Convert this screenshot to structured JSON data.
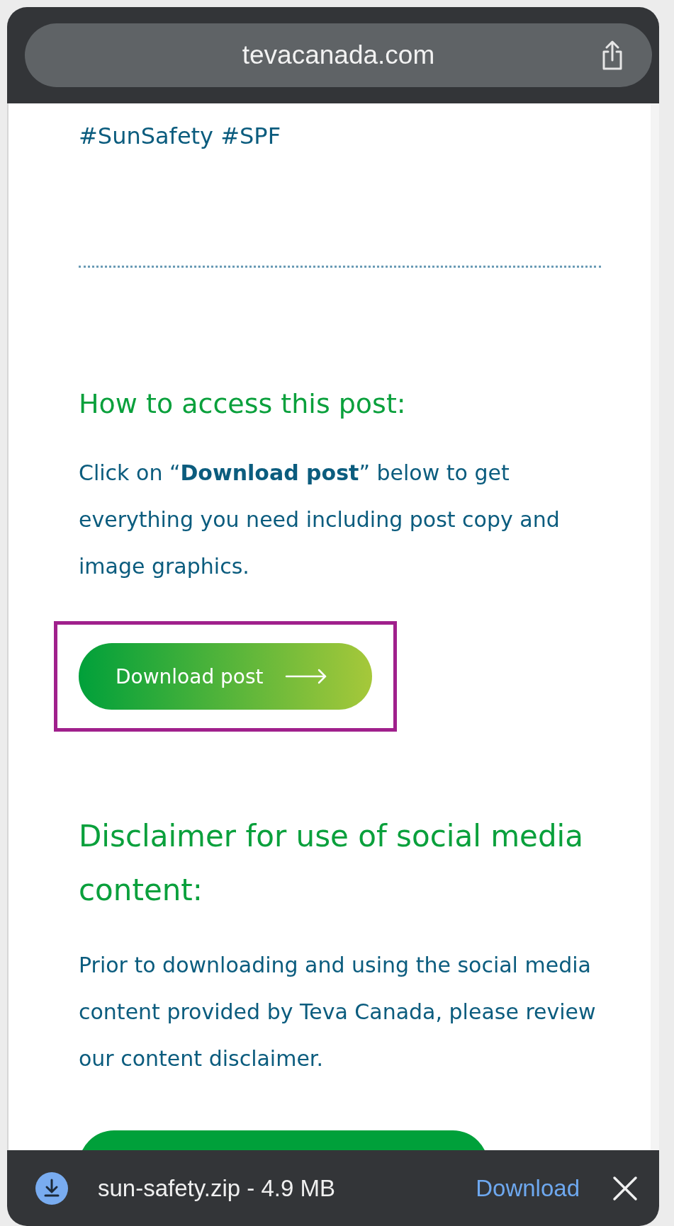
{
  "browser": {
    "url": "tevacanada.com"
  },
  "hashtags": "#SunSafety #SPF",
  "access_section": {
    "heading": "How to access this post:",
    "text": "Click on “**Download post**” below to get everything you need including post copy and image graphics.",
    "button": {
      "label": "Download post",
      "highlighted": true
    }
  },
  "disclaimer_section": {
    "heading": "Disclaimer for use of social media content:",
    "text": "Prior to downloading and using the social media content provided by Teva Canada, please review our content disclaimer."
  },
  "download_bar": {
    "file": "sun-safety.zip - 4.9 MB",
    "action": "Download"
  }
}
